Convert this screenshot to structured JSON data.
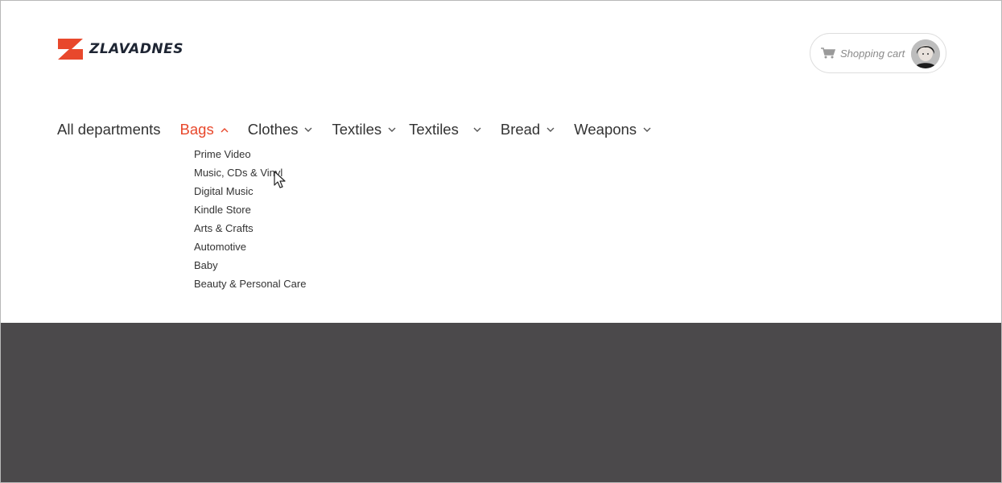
{
  "brand": {
    "name": "ZLAVADNES",
    "logo_icon": "z-logo-icon",
    "accent_color": "#e8482c",
    "text_color": "#1e2533"
  },
  "header": {
    "cart_label": "Shopping cart",
    "cart_icon": "shopping-cart-icon"
  },
  "nav": {
    "items": [
      {
        "label": "All departments",
        "has_dropdown": false
      },
      {
        "label": "Bags",
        "has_dropdown": true,
        "expanded": true
      },
      {
        "label": "Clothes",
        "has_dropdown": true
      },
      {
        "label": "Textiles",
        "has_dropdown": true
      },
      {
        "label": "Textiles",
        "has_dropdown": true
      },
      {
        "label": "Bread",
        "has_dropdown": true
      },
      {
        "label": "Weapons",
        "has_dropdown": true
      }
    ]
  },
  "dropdown": {
    "items": [
      "Prime Video",
      "Music, CDs & Vinyl",
      "Digital Music",
      "Kindle Store",
      "Arts & Crafts",
      "Automotive",
      "Baby",
      "Beauty & Personal Care"
    ]
  },
  "colors": {
    "page_background": "#ffffff",
    "dark_section": "#4b494b",
    "nav_text": "#333333"
  }
}
